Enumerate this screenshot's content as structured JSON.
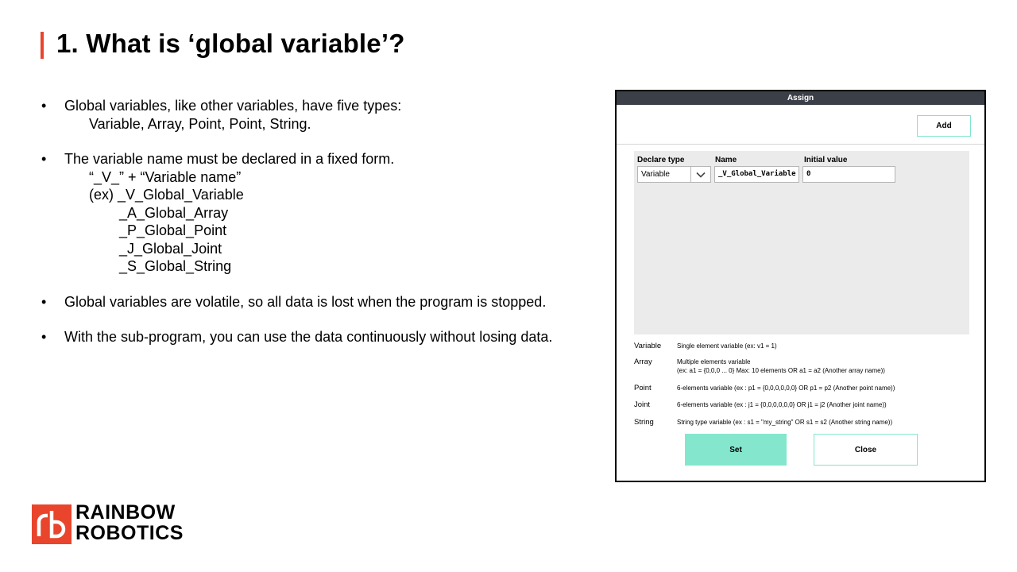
{
  "slide": {
    "title": "1. What is ‘global variable’?",
    "bullets": [
      {
        "dot": "•",
        "lines": [
          "Global variables, like other variables, have five types:"
        ],
        "sub": [
          "Variable, Array, Point, Point, String."
        ]
      },
      {
        "dot": "•",
        "lines": [
          "The variable name must be declared in a fixed form."
        ],
        "sub": [
          "“_V_” + “Variable name”",
          "(ex) _V_Global_Variable"
        ],
        "sub2": [
          "_A_Global_Array",
          "_P_Global_Point",
          "_J_Global_Joint",
          "_S_Global_String"
        ]
      },
      {
        "dot": "•",
        "lines": [
          "Global variables are volatile, so all data is lost when the program is stopped."
        ]
      },
      {
        "dot": "•",
        "lines": [
          "With the sub-program, you can use the data continuously without losing data."
        ]
      }
    ]
  },
  "dialog": {
    "title": "Assign",
    "add_label": "Add",
    "columns": {
      "type": "Declare type",
      "name": "Name",
      "initial": "Initial value"
    },
    "row": {
      "type": "Variable",
      "name": "_V_Global_Variable",
      "initial": "0"
    },
    "legend": [
      {
        "key": "Variable",
        "desc": [
          "Single element variable (ex: v1 = 1)"
        ]
      },
      {
        "key": "Array",
        "desc": [
          "Multiple elements variable",
          "(ex: a1 = {0,0,0 ... 0} Max: 10 elements OR a1 = a2 (Another array name))"
        ]
      },
      {
        "key": "Point",
        "desc": [
          "6-elements variable (ex : p1 = {0,0,0,0,0,0} OR p1 = p2 (Another point name))"
        ]
      },
      {
        "key": "Joint",
        "desc": [
          "6-elements variable (ex : j1 = {0,0,0,0,0,0} OR j1 = j2 (Another joint name))"
        ]
      },
      {
        "key": "String",
        "desc": [
          "String type variable (ex : s1 = \"my_string\" OR s1 = s2 (Another string name))"
        ]
      }
    ],
    "set_label": "Set",
    "close_label": "Close"
  },
  "logo": {
    "line1": "RAINBOW",
    "line2": "ROBOTICS",
    "brand_color": "#e8452c"
  },
  "colors": {
    "accent": "#e8452c",
    "button": "#84e6cd",
    "dialog_header": "#3b3f48"
  }
}
